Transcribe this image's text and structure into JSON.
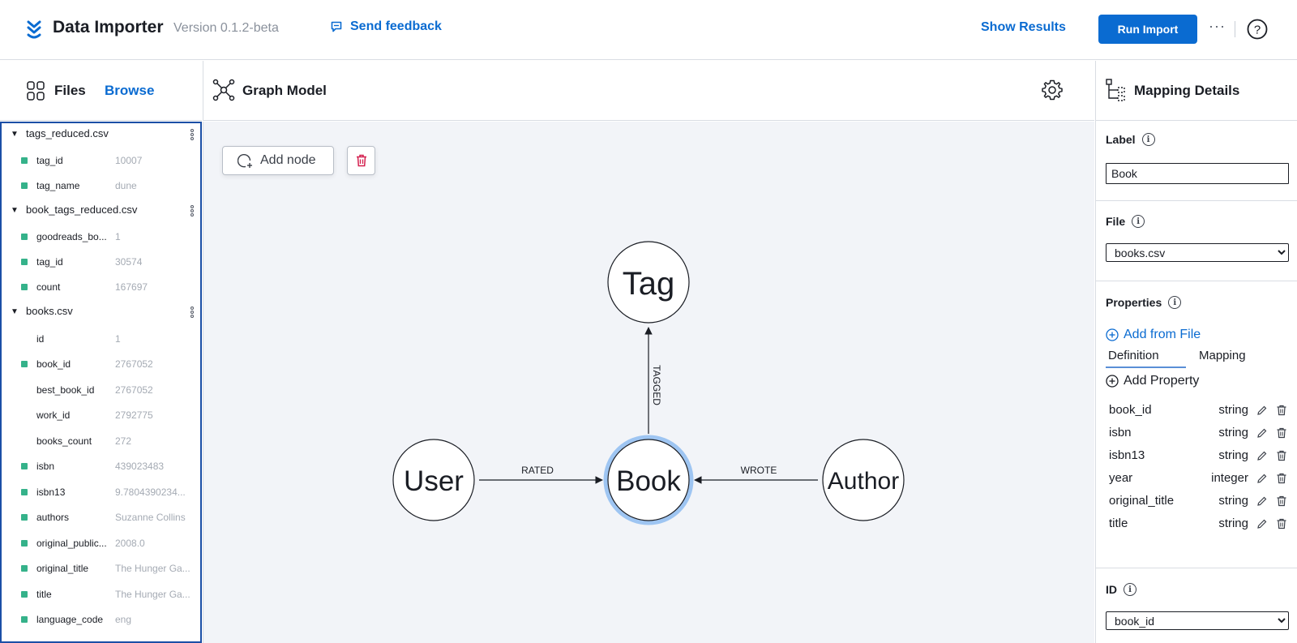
{
  "header": {
    "title": "Data Importer",
    "version": "Version 0.1.2-beta",
    "feedback": "Send feedback",
    "show_results": "Show Results",
    "run_import": "Run Import",
    "more": "···",
    "help": "?"
  },
  "files_panel": {
    "title": "Files",
    "browse": "Browse",
    "files": [
      {
        "name": "tags_reduced.csv",
        "fields": [
          {
            "name": "tag_id",
            "sample": "10007",
            "mapped": true
          },
          {
            "name": "tag_name",
            "sample": "dune",
            "mapped": true
          }
        ]
      },
      {
        "name": "book_tags_reduced.csv",
        "fields": [
          {
            "name": "goodreads_bo...",
            "sample": "1",
            "mapped": true
          },
          {
            "name": "tag_id",
            "sample": "30574",
            "mapped": true
          },
          {
            "name": "count",
            "sample": "167697",
            "mapped": true
          }
        ]
      },
      {
        "name": "books.csv",
        "fields": [
          {
            "name": "id",
            "sample": "1",
            "mapped": false
          },
          {
            "name": "book_id",
            "sample": "2767052",
            "mapped": true
          },
          {
            "name": "best_book_id",
            "sample": "2767052",
            "mapped": false
          },
          {
            "name": "work_id",
            "sample": "2792775",
            "mapped": false
          },
          {
            "name": "books_count",
            "sample": "272",
            "mapped": false
          },
          {
            "name": "isbn",
            "sample": "439023483",
            "mapped": true
          },
          {
            "name": "isbn13",
            "sample": "9.7804390234...",
            "mapped": true
          },
          {
            "name": "authors",
            "sample": "Suzanne Collins",
            "mapped": true
          },
          {
            "name": "original_public...",
            "sample": "2008.0",
            "mapped": true
          },
          {
            "name": "original_title",
            "sample": "The Hunger Ga...",
            "mapped": true
          },
          {
            "name": "title",
            "sample": "The Hunger Ga...",
            "mapped": true
          },
          {
            "name": "language_code",
            "sample": "eng",
            "mapped": true
          }
        ]
      }
    ]
  },
  "graph_panel": {
    "title": "Graph Model",
    "add_node": "Add node",
    "nodes": [
      "Tag",
      "User",
      "Book",
      "Author"
    ],
    "selected_node": "Book",
    "relationships": [
      {
        "label": "TAGGED",
        "from": "Book",
        "to": "Tag"
      },
      {
        "label": "RATED",
        "from": "User",
        "to": "Book"
      },
      {
        "label": "WROTE",
        "from": "Author",
        "to": "Book"
      }
    ]
  },
  "mapping_panel": {
    "title": "Mapping Details",
    "label_section": "Label",
    "label_value": "Book",
    "file_section": "File",
    "file_value": "books.csv",
    "properties_section": "Properties",
    "add_from_file": "Add from File",
    "tab_definition": "Definition",
    "tab_mapping": "Mapping",
    "add_property": "Add Property",
    "properties": [
      {
        "name": "book_id",
        "type": "string"
      },
      {
        "name": "isbn",
        "type": "string"
      },
      {
        "name": "isbn13",
        "type": "string"
      },
      {
        "name": "year",
        "type": "integer"
      },
      {
        "name": "original_title",
        "type": "string"
      },
      {
        "name": "title",
        "type": "string"
      }
    ],
    "id_section": "ID",
    "id_value": "book_id"
  },
  "colors": {
    "accent": "#0a6bd1",
    "mapped_field": "#35b28a",
    "selected_node_ring": "#9ec5f2",
    "delete": "#d4204f"
  }
}
